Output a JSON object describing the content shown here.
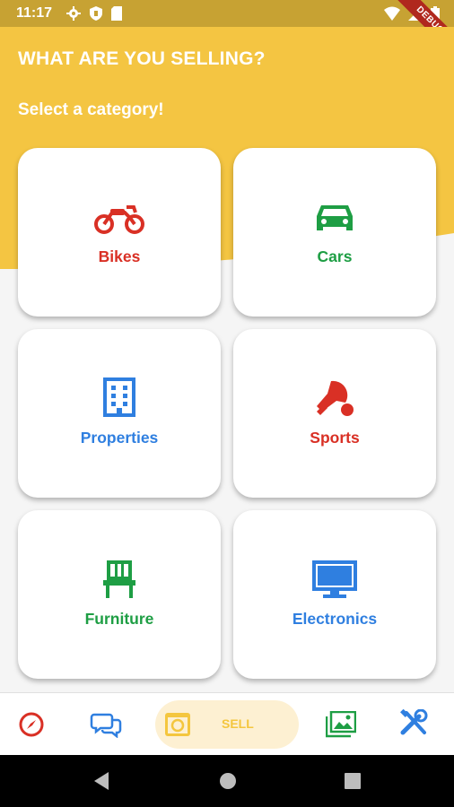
{
  "status_bar": {
    "time": "11:17",
    "debug_label": "DEBUG"
  },
  "header": {
    "title": "WHAT ARE YOU SELLING?",
    "subtitle": "Select a category!"
  },
  "categories": [
    {
      "label": "Bikes",
      "icon": "motorcycle-icon",
      "color": "#d93025"
    },
    {
      "label": "Cars",
      "icon": "car-icon",
      "color": "#1e9e44"
    },
    {
      "label": "Properties",
      "icon": "building-icon",
      "color": "#2f7fe0"
    },
    {
      "label": "Sports",
      "icon": "ping-pong-icon",
      "color": "#d93025"
    },
    {
      "label": "Furniture",
      "icon": "chair-icon",
      "color": "#1e9e44"
    },
    {
      "label": "Electronics",
      "icon": "monitor-icon",
      "color": "#2f7fe0"
    }
  ],
  "bottom_nav": {
    "items": [
      {
        "icon": "compass-icon",
        "color": "#d93025"
      },
      {
        "icon": "chat-icon",
        "color": "#2f7fe0"
      },
      {
        "icon": "camera-icon",
        "label": "SELL",
        "color": "#f4c63e",
        "active": true
      },
      {
        "icon": "gallery-icon",
        "color": "#1e9e44"
      },
      {
        "icon": "tools-icon",
        "color": "#2f7fe0"
      }
    ]
  },
  "colors": {
    "header": "#f4c542",
    "status_bar": "#c7a233",
    "background": "#f5f5f5"
  }
}
